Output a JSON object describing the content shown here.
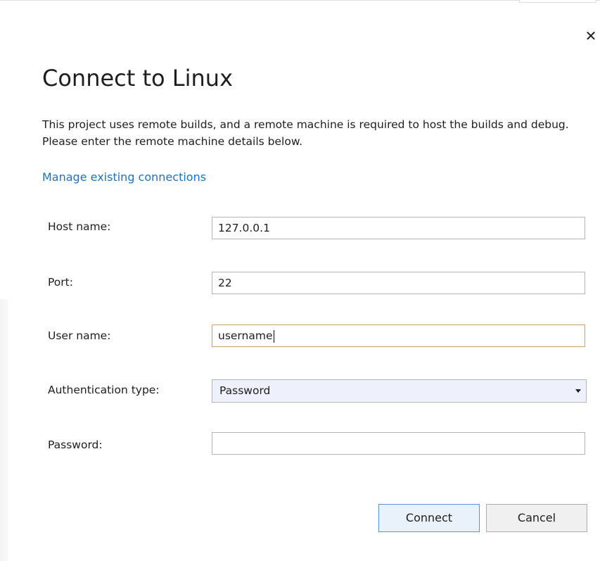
{
  "dialog": {
    "title": "Connect to Linux",
    "description": "This project uses remote builds, and a remote machine is required to host the builds and debug. Please enter the remote machine details below.",
    "manage_link": "Manage existing connections",
    "close_icon": "close-icon"
  },
  "form": {
    "host": {
      "label": "Host name:",
      "value": "127.0.0.1"
    },
    "port": {
      "label": "Port:",
      "value": "22"
    },
    "user": {
      "label": "User name:",
      "value": "username"
    },
    "auth": {
      "label": "Authentication type:",
      "value": "Password",
      "icon": "chevron-down-icon"
    },
    "password": {
      "label": "Password:",
      "value": ""
    }
  },
  "buttons": {
    "connect": "Connect",
    "cancel": "Cancel"
  },
  "colors": {
    "link": "#1a73c2",
    "focus_border": "#c8a560",
    "primary_border": "#5a93d3",
    "select_bg": "#eef0fb"
  }
}
